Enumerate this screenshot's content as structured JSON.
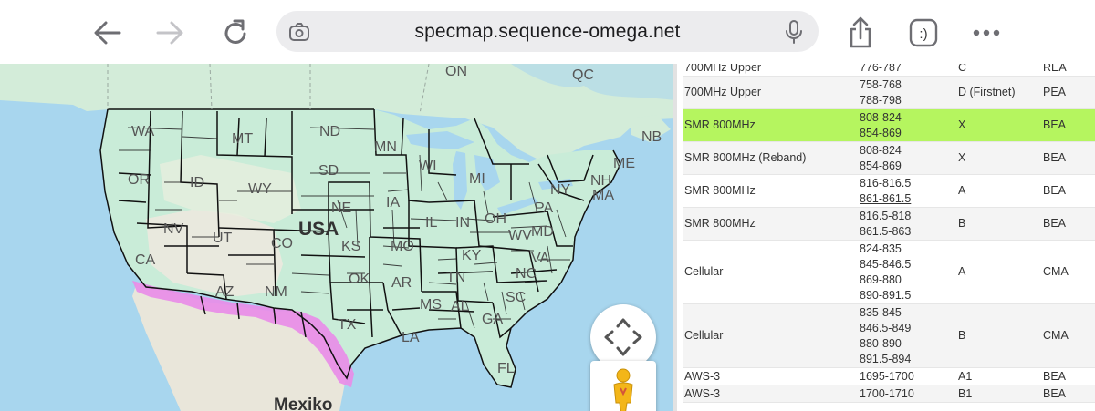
{
  "browser": {
    "url": "specmap.sequence-omega.net",
    "buttons": {
      "back": "back-arrow-icon",
      "forward": "forward-arrow-icon",
      "reload": "reload-icon",
      "share": "share-icon",
      "extension": ":)",
      "more": "more-icon"
    }
  },
  "map": {
    "labels": {
      "on": "ON",
      "qc": "QC",
      "nb": "NB",
      "wa": "WA",
      "mt": "MT",
      "nd": "ND",
      "mn": "MN",
      "me": "ME",
      "sd": "SD",
      "wi": "WI",
      "mi": "MI",
      "or": "OR",
      "id": "ID",
      "wy": "WY",
      "nh": "NH",
      "ny": "NY",
      "ma": "MA",
      "ia": "IA",
      "ne": "NE",
      "nv": "NV",
      "usa": "USA",
      "il": "IL",
      "in": "IN",
      "oh": "OH",
      "pa": "PA",
      "ut": "UT",
      "co": "CO",
      "ks": "KS",
      "mo": "MO",
      "wv": "WV",
      "md": "MD",
      "ca": "CA",
      "ky": "KY",
      "va": "VA",
      "ok": "OK",
      "tn": "TN",
      "nc": "NC",
      "az": "AZ",
      "nm": "NM",
      "ar": "AR",
      "ms": "MS",
      "al": "AL",
      "sc": "SC",
      "tx": "TX",
      "la": "LA",
      "ga": "GA",
      "fl": "FL",
      "mexico": "Mexiko"
    },
    "colors": {
      "water": "#a8d6ee",
      "land": "#d3ecd9",
      "us_region_fill": "#c9ecd8",
      "desert": "#efe9df",
      "highlight_market": "#e88de8",
      "border": "#111111"
    }
  },
  "table": {
    "rows": [
      {
        "service": "700MHz Upper",
        "freq": [
          "776-787"
        ],
        "block": "C",
        "area": "REA",
        "style": "cut"
      },
      {
        "service": "700MHz Upper",
        "freq": [
          "758-768",
          "788-798"
        ],
        "block": "D (Firstnet)",
        "area": "PEA",
        "style": "alt"
      },
      {
        "service": "SMR 800MHz",
        "freq": [
          "808-824",
          "854-869"
        ],
        "block": "X",
        "area": "BEA",
        "style": "highlight"
      },
      {
        "service": "SMR 800MHz (Reband)",
        "freq": [
          "808-824",
          "854-869"
        ],
        "block": "X",
        "area": "BEA",
        "style": "alt"
      },
      {
        "service": "SMR 800MHz",
        "freq": [
          "816-816.5",
          "861-861.5"
        ],
        "block": "A",
        "area": "BEA",
        "style": "plain"
      },
      {
        "service": "SMR 800MHz",
        "freq": [
          "816.5-818",
          "861.5-863"
        ],
        "block": "B",
        "area": "BEA",
        "style": "alt"
      },
      {
        "service": "Cellular",
        "freq": [
          "824-835",
          "845-846.5",
          "869-880",
          "890-891.5"
        ],
        "block": "A",
        "area": "CMA",
        "style": "plain"
      },
      {
        "service": "Cellular",
        "freq": [
          "835-845",
          "846.5-849",
          "880-890",
          "891.5-894"
        ],
        "block": "B",
        "area": "CMA",
        "style": "alt"
      },
      {
        "service": "AWS-3",
        "freq": [
          "1695-1700"
        ],
        "block": "A1",
        "area": "BEA",
        "style": "plain"
      },
      {
        "service": "AWS-3",
        "freq": [
          "1700-1710"
        ],
        "block": "B1",
        "area": "BEA",
        "style": "alt"
      }
    ],
    "highlight_color": "#b5f55f"
  }
}
